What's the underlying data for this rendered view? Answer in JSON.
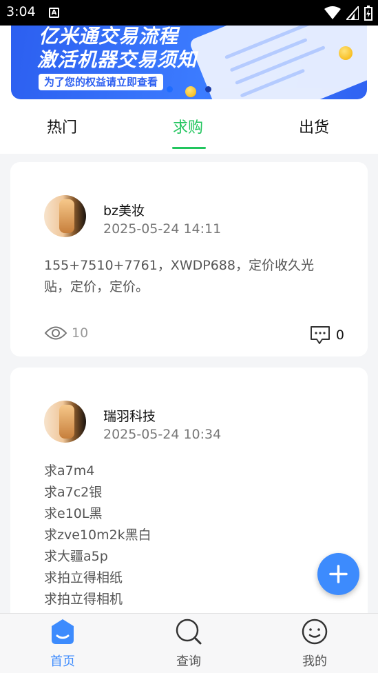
{
  "status_bar": {
    "time": "3:04",
    "notification_icon_letter": "A"
  },
  "banner": {
    "line1": "亿米通交易流程",
    "line2": "激活机器交易须知",
    "pill": "为了您的权益请立即查看"
  },
  "tabs": [
    {
      "label": "热门",
      "active": false
    },
    {
      "label": "求购",
      "active": true
    },
    {
      "label": "出货",
      "active": false
    }
  ],
  "posts": [
    {
      "username": "bz美妆",
      "time": "2025-05-24 14:11",
      "content_lines": [
        "155+7510+7761，XWDP688，定价收久光",
        "贴，定价，定价。"
      ],
      "views": "10",
      "comments": "0"
    },
    {
      "username": "瑞羽科技",
      "time": "2025-05-24 10:34",
      "content_lines": [
        "求a7m4",
        "求a7c2银",
        "求e10L黑",
        "求zve10m2k黑白",
        "求大疆a5p",
        "求拍立得相纸",
        "求拍立得相机"
      ]
    }
  ],
  "fab": {
    "icon": "plus-icon"
  },
  "bottom_nav": [
    {
      "label": "首页",
      "icon": "home-icon",
      "active": true
    },
    {
      "label": "查询",
      "icon": "search-icon",
      "active": false
    },
    {
      "label": "我的",
      "icon": "profile-icon",
      "active": false
    }
  ],
  "colors": {
    "accent_green": "#22c55e",
    "accent_blue": "#3d8bfd",
    "banner_blue": "#3c7cff"
  }
}
